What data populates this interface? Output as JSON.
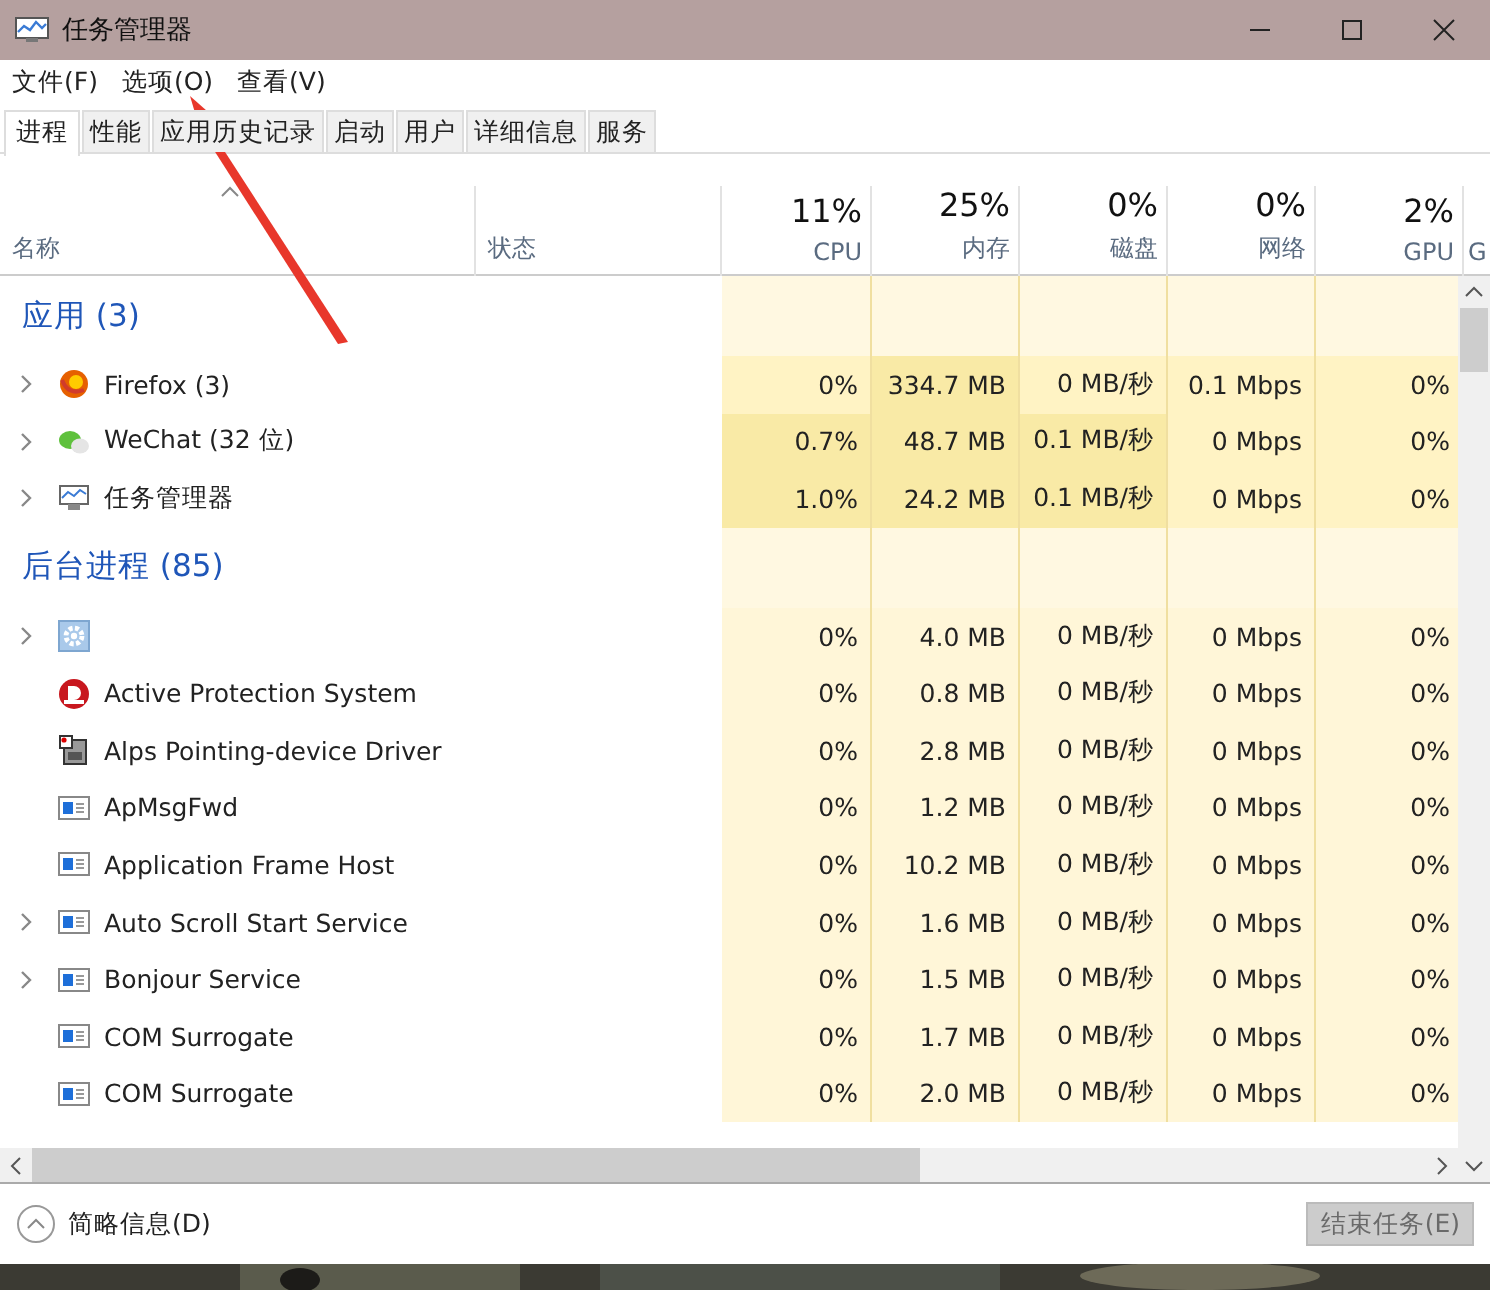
{
  "window": {
    "title": "任务管理器"
  },
  "menu": [
    "文件(F)",
    "选项(O)",
    "查看(V)"
  ],
  "tabs": [
    {
      "label": "进程",
      "selected": true
    },
    {
      "label": "性能",
      "selected": false
    },
    {
      "label": "应用历史记录",
      "selected": false
    },
    {
      "label": "启动",
      "selected": false
    },
    {
      "label": "用户",
      "selected": false
    },
    {
      "label": "详细信息",
      "selected": false
    },
    {
      "label": "服务",
      "selected": false
    }
  ],
  "columns": [
    {
      "label": "名称"
    },
    {
      "label": "状态"
    },
    {
      "usage": "11%",
      "label": "CPU"
    },
    {
      "usage": "25%",
      "label": "内存"
    },
    {
      "usage": "0%",
      "label": "磁盘"
    },
    {
      "usage": "0%",
      "label": "网络"
    },
    {
      "usage": "2%",
      "label": "GPU"
    },
    {
      "label": "G"
    }
  ],
  "groups": [
    {
      "title": "应用 (3)",
      "children": [
        {
          "kind": "browser",
          "name": "Firefox (3)",
          "expandable": true,
          "cells": [
            {
              "text": "0%",
              "color": "#fff3c4"
            },
            {
              "text": "334.7 MB",
              "color": "#f9eaa6"
            },
            {
              "text": "0 MB/秒",
              "color": "#fff3c4"
            },
            {
              "text": "0.1 Mbps",
              "color": "#fff3c4"
            },
            {
              "text": "0%",
              "color": "#fff3c4"
            }
          ]
        },
        {
          "kind": "chat",
          "name": "WeChat (32 位)",
          "expandable": true,
          "cells": [
            {
              "text": "0.7%",
              "color": "#f9eaa6"
            },
            {
              "text": "48.7 MB",
              "color": "#f9eaa6"
            },
            {
              "text": "0.1 MB/秒",
              "color": "#f9eaa6"
            },
            {
              "text": "0 Mbps",
              "color": "#fff3c4"
            },
            {
              "text": "0%",
              "color": "#fff3c4"
            }
          ]
        },
        {
          "kind": "monitor",
          "name": "任务管理器",
          "expandable": true,
          "cells": [
            {
              "text": "1.0%",
              "color": "#f9eaa6"
            },
            {
              "text": "24.2 MB",
              "color": "#f9eaa6"
            },
            {
              "text": "0.1 MB/秒",
              "color": "#f9eaa6"
            },
            {
              "text": "0 Mbps",
              "color": "#fff3c4"
            },
            {
              "text": "0%",
              "color": "#fff3c4"
            }
          ]
        }
      ]
    },
    {
      "title": "后台进程 (85)",
      "children": [
        {
          "kind": "gear",
          "expandable": true,
          "cells": [
            {
              "text": "0%",
              "color": "#fff6d8"
            },
            {
              "text": "4.0 MB",
              "color": "#fff6d8"
            },
            {
              "text": "0 MB/秒",
              "color": "#fff6d8"
            },
            {
              "text": "0 Mbps",
              "color": "#fff6d8"
            },
            {
              "text": "0%",
              "color": "#fff6d8"
            }
          ]
        },
        {
          "kind": "shield",
          "name": "Active Protection System",
          "expandable": false,
          "cells": [
            {
              "text": "0%",
              "color": "#fff6d8"
            },
            {
              "text": "0.8 MB",
              "color": "#fff6d8"
            },
            {
              "text": "0 MB/秒",
              "color": "#fff6d8"
            },
            {
              "text": "0 Mbps",
              "color": "#fff6d8"
            },
            {
              "text": "0%",
              "color": "#fff6d8"
            }
          ]
        },
        {
          "kind": "device",
          "name": "Alps Pointing-device Driver",
          "expandable": false,
          "cells": [
            {
              "text": "0%",
              "color": "#fff6d8"
            },
            {
              "text": "2.8 MB",
              "color": "#fff6d8"
            },
            {
              "text": "0 MB/秒",
              "color": "#fff6d8"
            },
            {
              "text": "0 Mbps",
              "color": "#fff6d8"
            },
            {
              "text": "0%",
              "color": "#fff6d8"
            }
          ]
        },
        {
          "kind": "service",
          "name": "ApMsgFwd",
          "expandable": false,
          "cells": [
            {
              "text": "0%",
              "color": "#fff6d8"
            },
            {
              "text": "1.2 MB",
              "color": "#fff6d8"
            },
            {
              "text": "0 MB/秒",
              "color": "#fff6d8"
            },
            {
              "text": "0 Mbps",
              "color": "#fff6d8"
            },
            {
              "text": "0%",
              "color": "#fff6d8"
            }
          ]
        },
        {
          "kind": "service",
          "name": "Application Frame Host",
          "expandable": false,
          "cells": [
            {
              "text": "0%",
              "color": "#fff6d8"
            },
            {
              "text": "10.2 MB",
              "color": "#fff6d8"
            },
            {
              "text": "0 MB/秒",
              "color": "#fff6d8"
            },
            {
              "text": "0 Mbps",
              "color": "#fff6d8"
            },
            {
              "text": "0%",
              "color": "#fff6d8"
            }
          ]
        },
        {
          "kind": "service",
          "name": "Auto Scroll Start Service",
          "expandable": true,
          "cells": [
            {
              "text": "0%",
              "color": "#fff6d8"
            },
            {
              "text": "1.6 MB",
              "color": "#fff6d8"
            },
            {
              "text": "0 MB/秒",
              "color": "#fff6d8"
            },
            {
              "text": "0 Mbps",
              "color": "#fff6d8"
            },
            {
              "text": "0%",
              "color": "#fff6d8"
            }
          ]
        },
        {
          "kind": "service",
          "name": "Bonjour Service",
          "expandable": true,
          "cells": [
            {
              "text": "0%",
              "color": "#fff6d8"
            },
            {
              "text": "1.5 MB",
              "color": "#fff6d8"
            },
            {
              "text": "0 MB/秒",
              "color": "#fff6d8"
            },
            {
              "text": "0 Mbps",
              "color": "#fff6d8"
            },
            {
              "text": "0%",
              "color": "#fff6d8"
            }
          ]
        },
        {
          "kind": "service",
          "name": "COM Surrogate",
          "expandable": false,
          "cells": [
            {
              "text": "0%",
              "color": "#fff6d8"
            },
            {
              "text": "1.7 MB",
              "color": "#fff6d8"
            },
            {
              "text": "0 MB/秒",
              "color": "#fff6d8"
            },
            {
              "text": "0 Mbps",
              "color": "#fff6d8"
            },
            {
              "text": "0%",
              "color": "#fff6d8"
            }
          ]
        },
        {
          "kind": "service",
          "name": "COM Surrogate",
          "expandable": false,
          "cells": [
            {
              "text": "0%",
              "color": "#fff6d8"
            },
            {
              "text": "2.0 MB",
              "color": "#fff6d8"
            },
            {
              "text": "0 MB/秒",
              "color": "#fff6d8"
            },
            {
              "text": "0 Mbps",
              "color": "#fff6d8"
            },
            {
              "text": "0%",
              "color": "#fff6d8"
            }
          ]
        }
      ]
    }
  ],
  "footer": {
    "details_toggle": "简略信息(D)",
    "end_task": {
      "label": "结束任务(E)",
      "disabled": true
    }
  }
}
